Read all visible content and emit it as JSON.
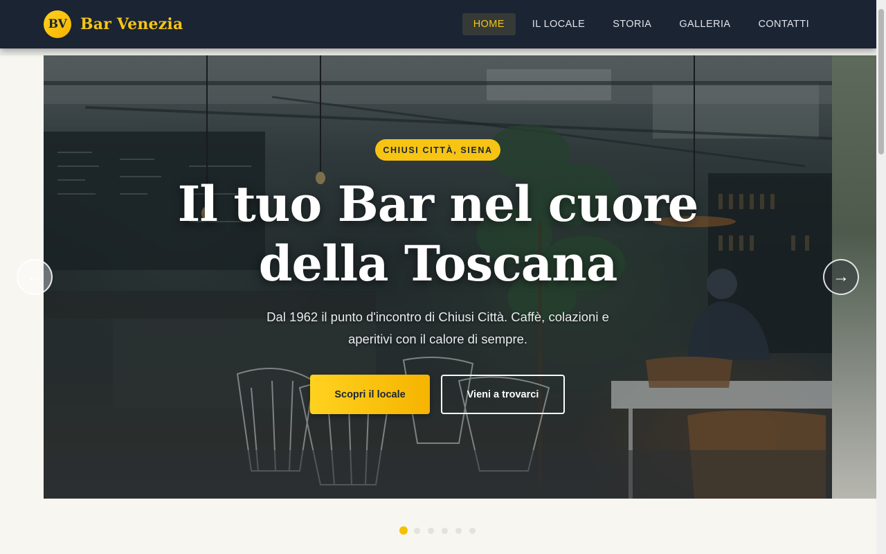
{
  "header": {
    "logo_text": "BV",
    "brand_name": "Bar Venezia",
    "nav": [
      {
        "label": "HOME",
        "active": true
      },
      {
        "label": "IL LOCALE",
        "active": false
      },
      {
        "label": "STORIA",
        "active": false
      },
      {
        "label": "GALLERIA",
        "active": false
      },
      {
        "label": "CONTATTI",
        "active": false
      }
    ]
  },
  "hero": {
    "badge": "CHIUSI CITTÀ, SIENA",
    "title": "Il tuo Bar nel cuore della Toscana",
    "subtitle": "Dal 1962 il punto d'incontro di Chiusi Città. Caffè, colazioni e aperitivi con il calore di sempre.",
    "primary_button": "Scopri il locale",
    "secondary_button": "Vieni a trovarci",
    "prev_arrow": "←",
    "next_arrow": "→",
    "slides_total": 6,
    "active_slide": 1
  },
  "colors": {
    "header_bg": "#1b2433",
    "accent": "#f6c515",
    "page_bg": "#f7f6f1"
  },
  "icons": [
    "arrow-left-icon",
    "arrow-right-icon"
  ]
}
